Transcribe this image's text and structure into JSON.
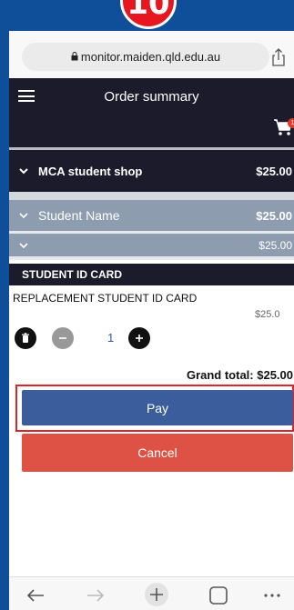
{
  "step_badge": "10",
  "browser": {
    "url": "monitor.maiden.qld.edu.au"
  },
  "header": {
    "title": "Order summary",
    "cart_count": "1"
  },
  "order": {
    "shop": {
      "label": "MCA student shop",
      "amount": "$25.00"
    },
    "student": {
      "label": "Student Name",
      "amount": "$25.00"
    },
    "subgroup": {
      "amount": "$25.00"
    },
    "section_title": "STUDENT ID CARD",
    "item": {
      "name": "REPLACEMENT STUDENT ID CARD",
      "price": "$25.0",
      "quantity": "1"
    },
    "grand_total": "Grand total: $25.00"
  },
  "actions": {
    "pay_label": "Pay",
    "cancel_label": "Cancel"
  },
  "colors": {
    "dark_header": "#1b1b2b",
    "group_bg": "#8d9cae",
    "pay": "#3b5d9b",
    "cancel": "#dd5245",
    "highlight": "#d9262b",
    "badge": "#e8171f"
  },
  "toolbar_icons": [
    "back-arrow-icon",
    "forward-arrow-icon",
    "new-tab-plus-icon",
    "tabs-square-icon",
    "more-dots-icon"
  ]
}
